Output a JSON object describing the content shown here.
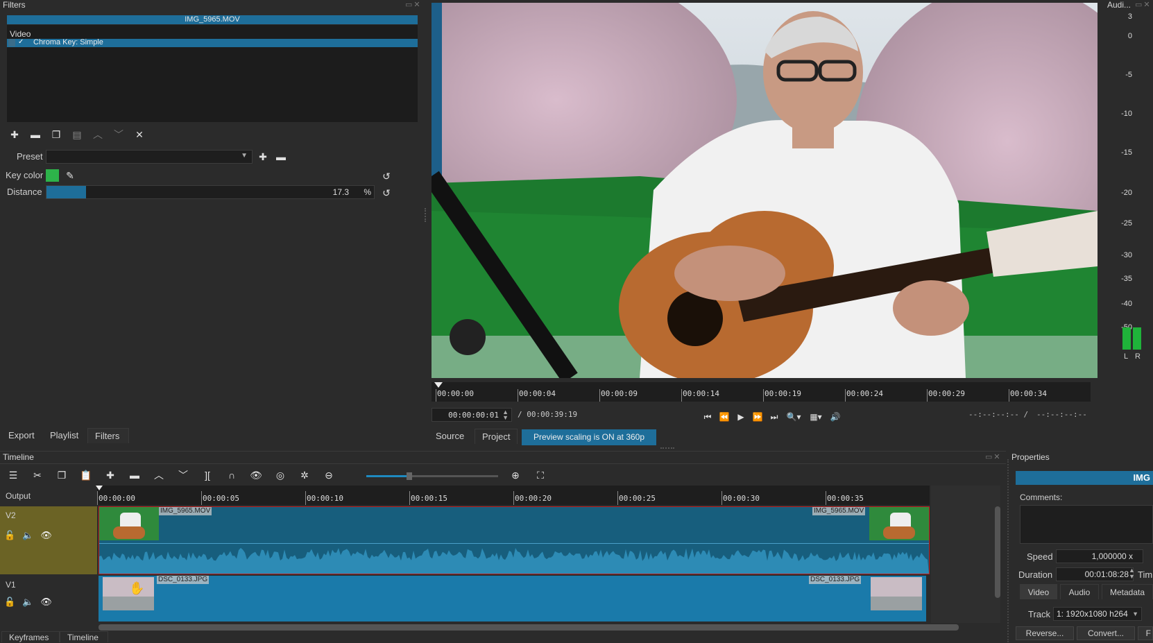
{
  "filters": {
    "title": "Filters",
    "clip_name": "IMG_5965.MOV",
    "category": "Video",
    "filter_item": "Chroma Key: Simple",
    "filter_checked": "✓",
    "preset_label": "Preset",
    "key_color_label": "Key color",
    "key_color": "#2db34a",
    "distance_label": "Distance",
    "distance_value": "17.3",
    "distance_unit": "%",
    "distance_fraction": 0.12
  },
  "bottom_tabs_left": [
    "Export",
    "Playlist",
    "Filters"
  ],
  "player": {
    "ruler": [
      "00:00:00",
      "00:00:04",
      "00:00:09",
      "00:00:14",
      "00:00:19",
      "00:00:24",
      "00:00:29",
      "00:00:34"
    ],
    "current_time": "00:00:00:01",
    "total_time": "/ 00:00:39:19",
    "in_point": "--:--:--:-- /",
    "out_point": "--:--:--:--",
    "source_tab": "Source",
    "project_tab": "Project",
    "scaling_notice": "Preview scaling is ON at 360p"
  },
  "audio": {
    "title": "Audi...",
    "scale": [
      "3",
      "0",
      "-5",
      "-10",
      "-15",
      "-20",
      "-25",
      "-30",
      "-35",
      "-40",
      "-50"
    ],
    "left_label": "L",
    "right_label": "R"
  },
  "timeline": {
    "title": "Timeline",
    "output_label": "Output",
    "ruler": [
      "00:00:00",
      "00:00:05",
      "00:00:10",
      "00:00:15",
      "00:00:20",
      "00:00:25",
      "00:00:30",
      "00:00:35"
    ],
    "tracks": [
      {
        "name": "V2",
        "clip_start": "IMG_5965.MOV",
        "clip_end": "IMG_5965.MOV"
      },
      {
        "name": "V1",
        "clip_start": "DSC_0133.JPG",
        "clip_end": "DSC_0133.JPG"
      }
    ],
    "bottom_tabs": [
      "Keyframes",
      "Timeline"
    ]
  },
  "properties": {
    "title": "Properties",
    "header": "IMG",
    "comments_label": "Comments:",
    "speed_label": "Speed",
    "speed_value": "1,000000 x",
    "duration_label": "Duration",
    "duration_value": "00:01:08:28",
    "time_label": "Tim",
    "tabs": [
      "Video",
      "Audio",
      "Metadata"
    ],
    "track_label": "Track",
    "track_value": "1: 1920x1080 h264",
    "reverse_button": "Reverse...",
    "convert_button": "Convert...",
    "extra_button": "F"
  }
}
